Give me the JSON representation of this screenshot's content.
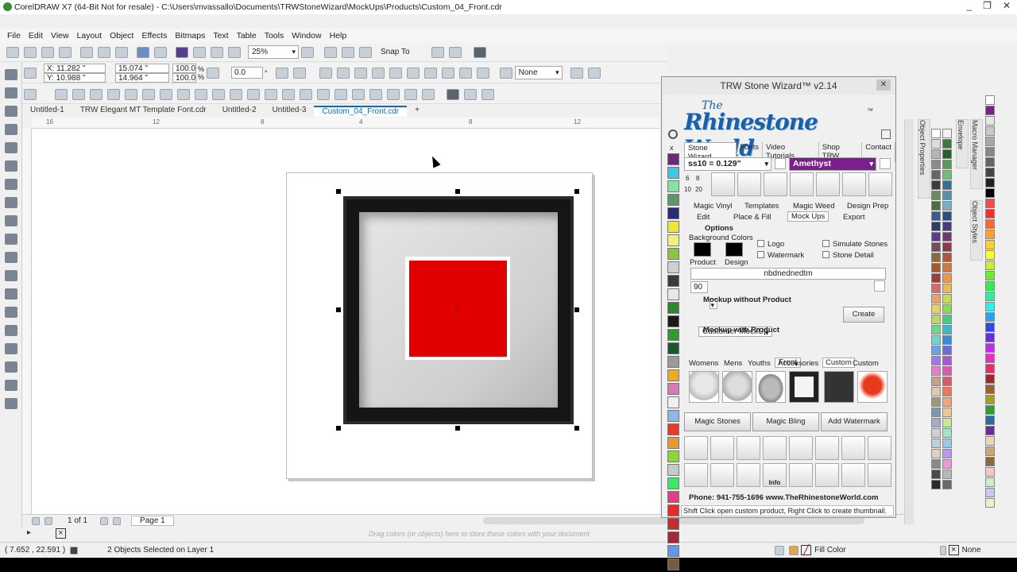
{
  "window": {
    "title": "CorelDRAW X7 (64-Bit Not for resale) - C:\\Users\\mvassallo\\Documents\\TRWStoneWizard\\MockUps\\Products\\Custom_04_Front.cdr",
    "controls": [
      "_",
      "❐",
      "✕"
    ]
  },
  "menu": [
    "File",
    "Edit",
    "View",
    "Layout",
    "Object",
    "Effects",
    "Bitmaps",
    "Text",
    "Table",
    "Tools",
    "Window",
    "Help"
  ],
  "toolbar1": {
    "zoom": "25%",
    "snap_to": "Snap To"
  },
  "propbar": {
    "x": "X: 11.282 \"",
    "y": "Y: 10.988 \"",
    "w": "15.074 \"",
    "h": "14.964 \"",
    "sx": "100.0",
    "sy": "100.0",
    "pct1": "%",
    "pct2": "%",
    "angle": "0.0",
    "deg": "°",
    "outline": "None"
  },
  "doc_tabs": [
    "Untitled-1",
    "TRW Elegant MT Template Font.cdr",
    "Untitled-2",
    "Untitled-3",
    "Custom_04_Front.cdr",
    "+"
  ],
  "ruler_labels": [
    "16",
    "12",
    "8",
    "4",
    "0",
    "4",
    "8",
    "12",
    "16"
  ],
  "page_nav": {
    "count": "1 of 1",
    "page": "Page 1"
  },
  "drag_hint": "Drag colors (or objects) here to store these colors with your document",
  "status": {
    "coords": "( 7.652 , 22.591 )",
    "selection": "2 Objects Selected on Layer 1",
    "fill": "Fill Color",
    "outline": "None"
  },
  "dockers": {
    "object_properties": "Object Properties",
    "envelope": "Envelope",
    "macro_manager": "Macro Manager",
    "object_styles": "Object Styles"
  },
  "wizard": {
    "title": "TRW Stone Wizard™ v2.14",
    "close": "✕",
    "logo_the": "The",
    "logo_name": "Rhinestone World",
    "logo_tm": "™",
    "tabs": [
      "Stone Wizard",
      "Fonts",
      "Video Tutorials",
      "Shop TRW",
      "Contact"
    ],
    "stone_size": "ss10 = 0.129\"",
    "stone_color": "Amethyst",
    "size_buttons": [
      "6",
      "8",
      "10",
      "20"
    ],
    "subtabs_row1": [
      "Magic Vinyl",
      "Templates",
      "Magic Weed",
      "Design Prep"
    ],
    "subtabs_row2": [
      "Edit",
      "Place & Fill",
      "Mock Ups",
      "Export"
    ],
    "options_label": "Options",
    "bg_colors_label": "Background Colors",
    "product_label": "Product",
    "design_label": "Design",
    "chk_logo": "Logo",
    "chk_watermark": "Watermark",
    "chk_simulate": "Simulate Stones",
    "chk_detail": "Stone Detail",
    "watermark_text": "nbdnednedtm",
    "opacity": "90",
    "mockup_without_label": "Mockup without Product",
    "mockup_without_value": "Customer MockUp",
    "create_button": "Create",
    "mockup_with_label": "Mockup with Product",
    "mockup_with_value": "Front",
    "product_tabs": [
      "Womens",
      "Mens",
      "Youths",
      "Accessories",
      "Custom",
      "Custom"
    ],
    "magic_stones": "Magic Stones",
    "magic_bling": "Magic Bling",
    "add_watermark": "Add Watermark",
    "info_label": "Info",
    "phone": "Phone: 941-755-1696  www.TheRhinestoneWorld.com",
    "hint": "Shift Click open custom product, Right Click to create thumbnail."
  },
  "colors": {
    "accent": "#0b6cc4",
    "amethyst": "#7a1f8c",
    "design_red": "#e10000",
    "frame": "#1a1a1a"
  }
}
